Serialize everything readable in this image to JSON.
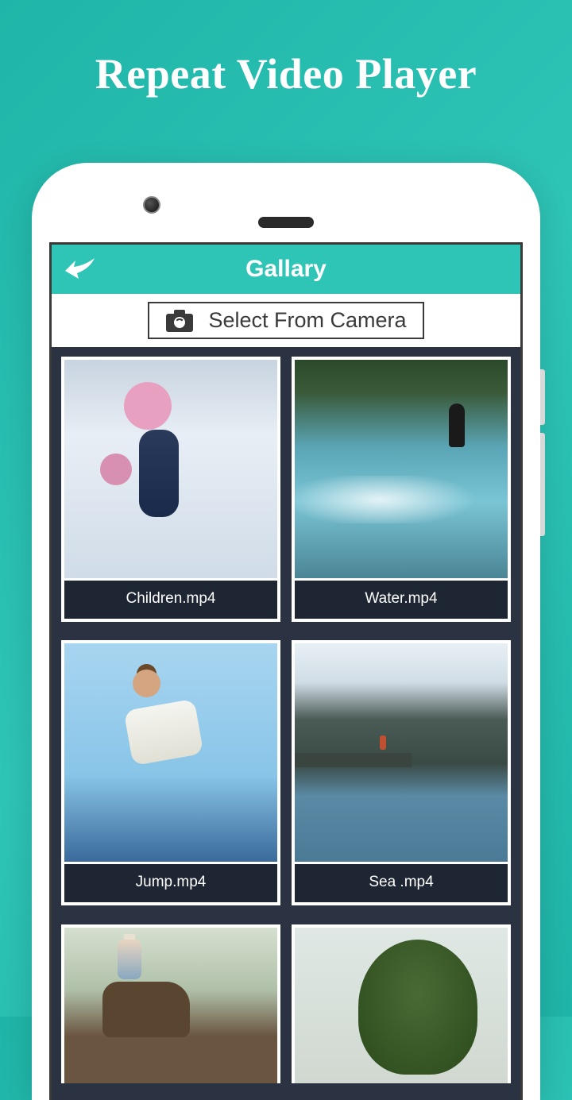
{
  "marketing": {
    "title": "Repeat Video Player"
  },
  "header": {
    "title": "Gallary"
  },
  "camera_button": {
    "label": "Select From Camera"
  },
  "videos": [
    {
      "label": "Children.mp4"
    },
    {
      "label": "Water.mp4"
    },
    {
      "label": "Jump.mp4"
    },
    {
      "label": "Sea .mp4"
    },
    {
      "label": ""
    },
    {
      "label": ""
    }
  ]
}
